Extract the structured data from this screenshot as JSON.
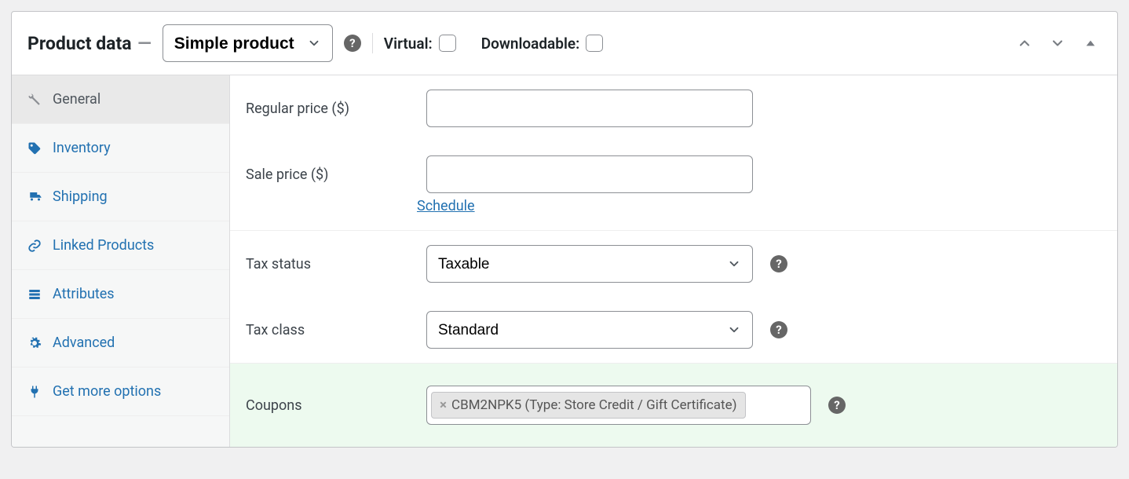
{
  "header": {
    "title": "Product data",
    "dash": "—",
    "product_type": "Simple product",
    "virtual_label": "Virtual:",
    "downloadable_label": "Downloadable:"
  },
  "sidebar": {
    "items": [
      {
        "label": "General"
      },
      {
        "label": "Inventory"
      },
      {
        "label": "Shipping"
      },
      {
        "label": "Linked Products"
      },
      {
        "label": "Attributes"
      },
      {
        "label": "Advanced"
      },
      {
        "label": "Get more options"
      }
    ]
  },
  "fields": {
    "regular_price_label": "Regular price ($)",
    "regular_price_value": "",
    "sale_price_label": "Sale price ($)",
    "sale_price_value": "",
    "schedule_link": "Schedule",
    "tax_status_label": "Tax status",
    "tax_status_value": "Taxable",
    "tax_class_label": "Tax class",
    "tax_class_value": "Standard",
    "coupons_label": "Coupons",
    "coupon_chip": "CBM2NPK5 (Type: Store Credit / Gift Certificate)"
  }
}
